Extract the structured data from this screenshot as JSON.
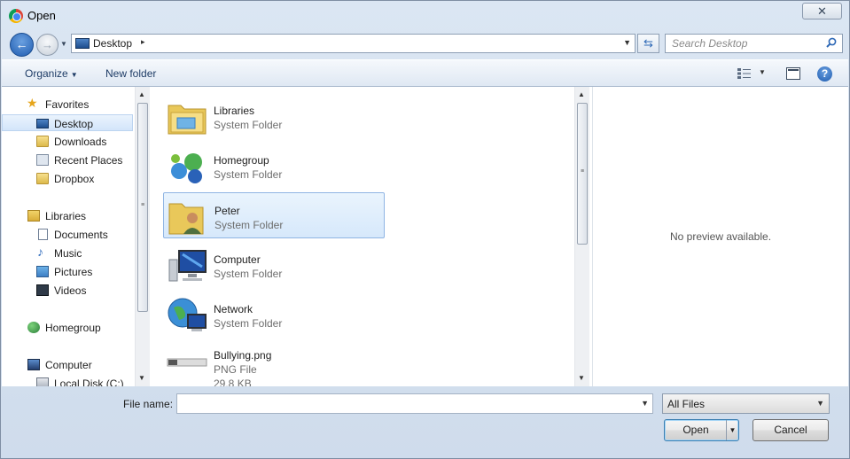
{
  "window": {
    "title": "Open",
    "close_glyph": "✕"
  },
  "address_bar": {
    "path": "Desktop",
    "separator": "▸",
    "dropdown": "▾"
  },
  "search": {
    "placeholder": "Search Desktop"
  },
  "toolbar": {
    "organize": "Organize",
    "new_folder": "New folder",
    "help": "?"
  },
  "nav": {
    "items": [
      {
        "label": "Favorites",
        "icon": "star-icon"
      },
      {
        "label": "Desktop",
        "icon": "desktop-icon",
        "selected": true
      },
      {
        "label": "Downloads",
        "icon": "folder-icon"
      },
      {
        "label": "Recent Places",
        "icon": "recent-places-icon"
      },
      {
        "label": "Dropbox",
        "icon": "folder-icon"
      },
      {
        "label": "Libraries",
        "icon": "libraries-icon"
      },
      {
        "label": "Documents",
        "icon": "document-icon"
      },
      {
        "label": "Music",
        "icon": "music-icon"
      },
      {
        "label": "Pictures",
        "icon": "pictures-icon"
      },
      {
        "label": "Videos",
        "icon": "videos-icon"
      },
      {
        "label": "Homegroup",
        "icon": "homegroup-icon"
      },
      {
        "label": "Computer",
        "icon": "computer-icon"
      },
      {
        "label": "Local Disk (C:)",
        "icon": "disk-icon"
      }
    ]
  },
  "files": [
    {
      "name": "Libraries",
      "type": "System Folder",
      "icon": "libraries-folder-icon"
    },
    {
      "name": "Homegroup",
      "type": "System Folder",
      "icon": "homegroup-icon"
    },
    {
      "name": "Peter",
      "type": "System Folder",
      "icon": "user-folder-icon",
      "selected": true
    },
    {
      "name": "Computer",
      "type": "System Folder",
      "icon": "computer-icon"
    },
    {
      "name": "Network",
      "type": "System Folder",
      "icon": "network-icon"
    },
    {
      "name": "Bullying.png",
      "type": "PNG File",
      "size": "29.8 KB",
      "icon": "image-thumbnail-icon"
    }
  ],
  "preview": {
    "text": "No preview available."
  },
  "bottom": {
    "file_name_label": "File name:",
    "file_name_value": "",
    "file_type": "All Files",
    "open_label": "Open",
    "cancel_label": "Cancel"
  }
}
